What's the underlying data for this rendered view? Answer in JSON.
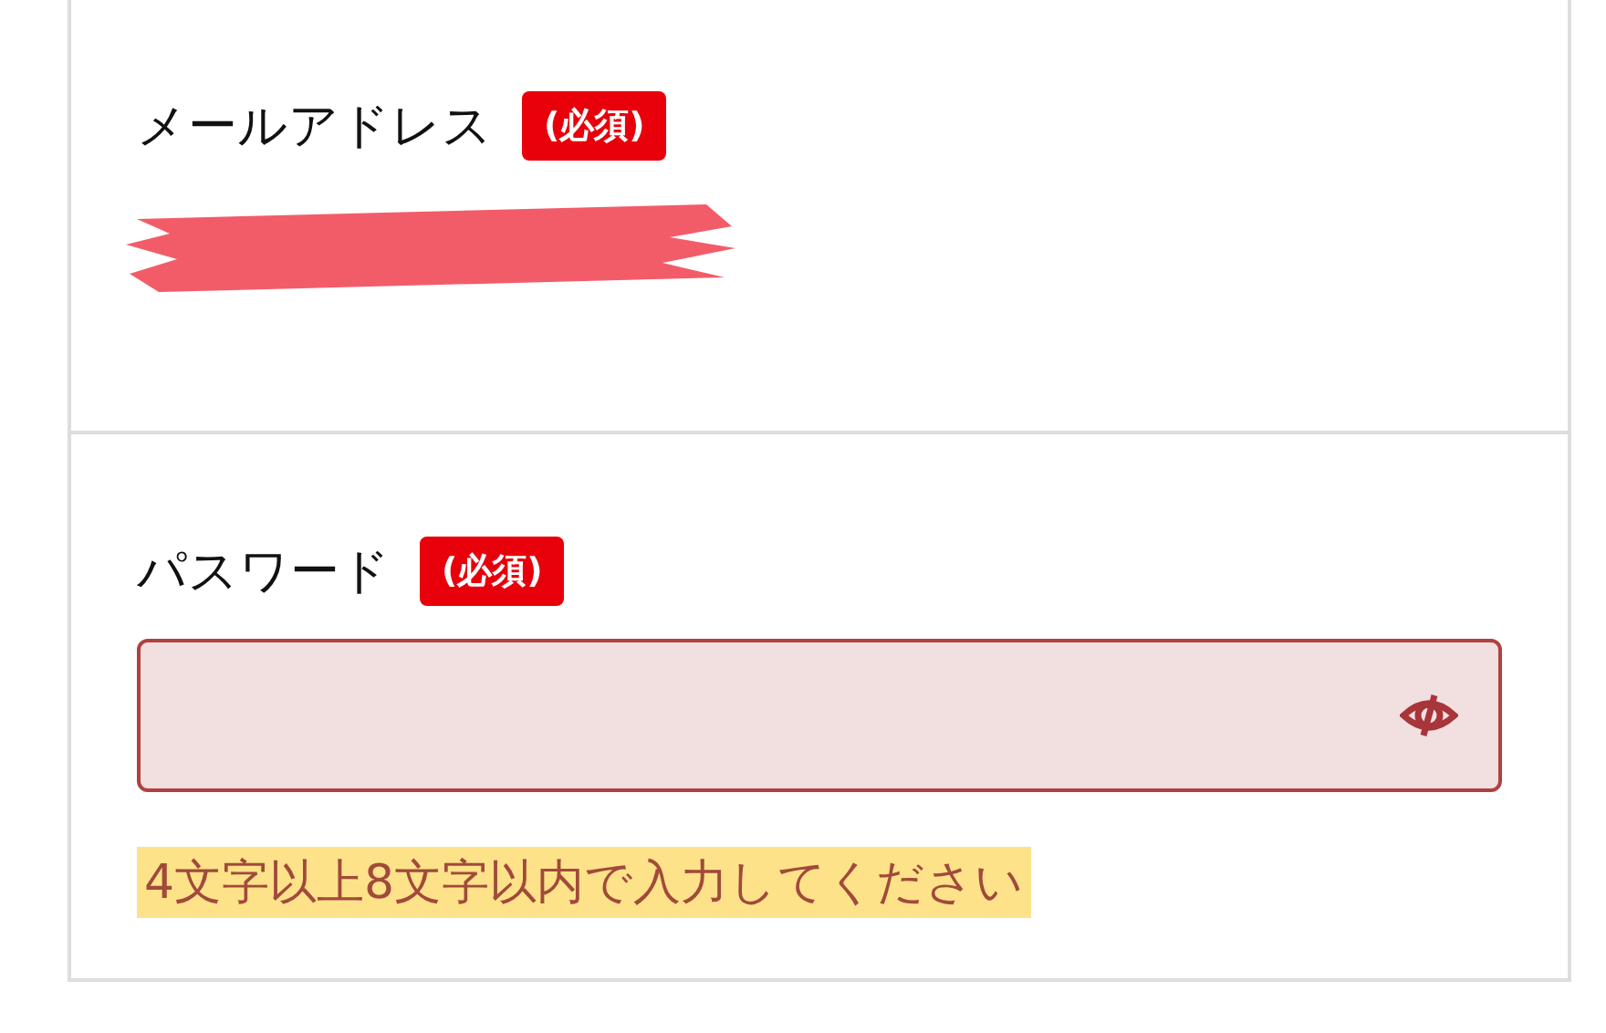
{
  "sections": [
    {
      "label": "メールアドレス",
      "badge": "(必須)",
      "kind": "redacted"
    },
    {
      "label": "パスワード",
      "badge": "(必須)",
      "kind": "password",
      "invalid": true,
      "error": "4文字以上8文字以内で入力してください"
    }
  ]
}
